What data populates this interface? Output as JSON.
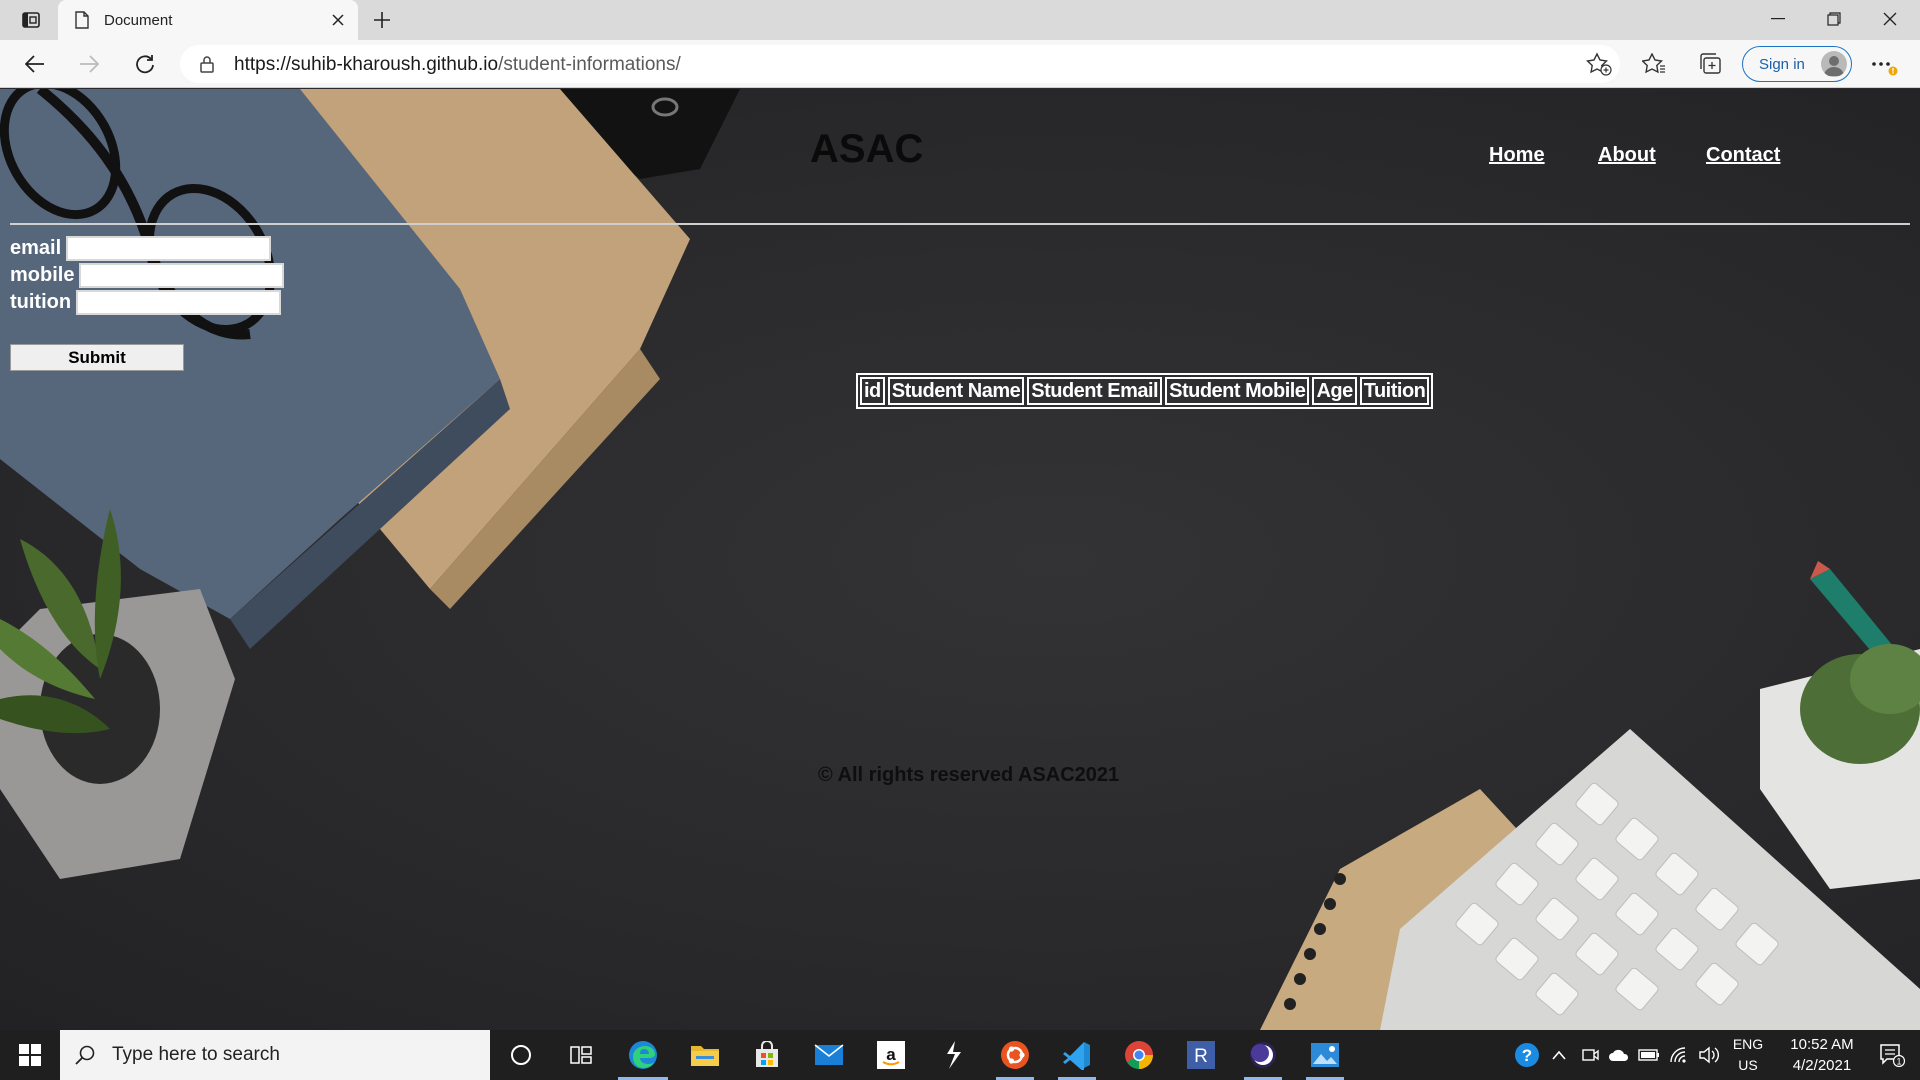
{
  "browser": {
    "tab_title": "Document",
    "url_host": "https://suhib-kharoush.github.io",
    "url_path": "/student-informations/",
    "sign_in_label": "Sign in"
  },
  "page": {
    "site_title": "ASAC",
    "nav": [
      "Home",
      "About",
      "Contact"
    ],
    "form": {
      "fields": [
        {
          "label": "email",
          "value": ""
        },
        {
          "label": "mobile",
          "value": ""
        },
        {
          "label": "tuition",
          "value": ""
        }
      ],
      "submit_label": "Submit"
    },
    "table": {
      "headers": [
        "id",
        "Student Name",
        "Student Email",
        "Student Mobile",
        "Age",
        "Tuition"
      ],
      "rows": []
    },
    "footer": "© All rights reserved ASAC2021"
  },
  "taskbar": {
    "search_placeholder": "Type here to search",
    "apps": [
      "cortana-icon",
      "task-view-icon",
      "edge-icon",
      "file-explorer-icon",
      "store-icon",
      "mail-icon",
      "amazon-icon",
      "swift-icon",
      "ubuntu-icon",
      "vscode-icon",
      "chrome-icon",
      "r-icon",
      "eclipse-icon",
      "photos-icon"
    ],
    "lang_line1": "ENG",
    "lang_line2": "US",
    "time": "10:52 AM",
    "date": "4/2/2021",
    "notification_count": "1"
  },
  "colors": {
    "accent": "#1a73c8",
    "page_background": "#2b2b2d",
    "taskbar": "#1f1f1f"
  }
}
